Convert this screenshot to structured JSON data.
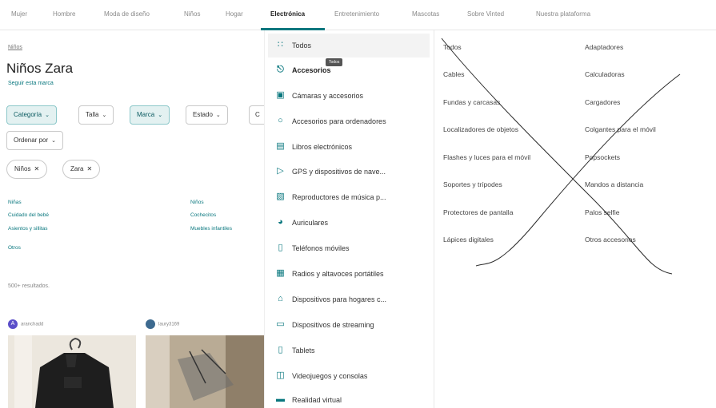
{
  "nav": {
    "items": [
      "Mujer",
      "Hombre",
      "Moda de diseño",
      "Niños",
      "Hogar",
      "Electrónica",
      "Entretenimiento",
      "Mascotas",
      "Sobre Vinted",
      "Nuestra plataforma"
    ],
    "active": "Electrónica",
    "accent": "#09777e"
  },
  "page": {
    "breadcrumb": "Niños",
    "title": "Niños Zara",
    "follow": "Seguir esta marca",
    "filters": [
      "Categoría",
      "Talla",
      "Marca",
      "Estado",
      "C"
    ],
    "sort": "Ordenar por",
    "chips": [
      "Niños",
      "Zara"
    ],
    "subcategories_left": [
      "Niñas",
      "Cuidado del bebé",
      "Asientos y sillitas",
      "Otros"
    ],
    "subcategories_right": [
      "Niños",
      "Cochecitos",
      "Muebles infantiles"
    ],
    "results": "500+ resultados.",
    "users": [
      "aranchadd",
      "laury3169"
    ],
    "avatar_letter": "A"
  },
  "menu": {
    "items": [
      {
        "label": "Todos",
        "icon": "grid-icon"
      },
      {
        "label": "Accesorios",
        "icon": "plug-icon"
      },
      {
        "label": "Cámaras y accesorios",
        "icon": "camera-icon"
      },
      {
        "label": "Accesorios para ordenadores",
        "icon": "mouse-icon"
      },
      {
        "label": "Libros electrónicos",
        "icon": "ebook-icon"
      },
      {
        "label": "GPS y dispositivos de nave...",
        "icon": "navigation-icon"
      },
      {
        "label": "Reproductores de música p...",
        "icon": "music-player-icon"
      },
      {
        "label": "Auriculares",
        "icon": "headphones-icon"
      },
      {
        "label": "Teléfonos móviles",
        "icon": "phone-icon"
      },
      {
        "label": "Radios y altavoces portátiles",
        "icon": "radio-icon"
      },
      {
        "label": "Dispositivos para hogares c...",
        "icon": "smart-home-icon"
      },
      {
        "label": "Dispositivos de streaming",
        "icon": "tv-icon"
      },
      {
        "label": "Tablets",
        "icon": "tablet-icon"
      },
      {
        "label": "Videojuegos y consolas",
        "icon": "gamepad-icon"
      },
      {
        "label": "Realidad virtual",
        "icon": "vr-icon"
      }
    ],
    "tooltip": "Todos",
    "subitems_left": [
      "Todos",
      "Cables",
      "Fundas y carcasas",
      "Localizadores de objetos",
      "Flashes y luces para el móvil",
      "Soportes y trípodes",
      "Protectores de pantalla",
      "Lápices digitales"
    ],
    "subitems_right": [
      "Adaptadores",
      "Calculadoras",
      "Cargadores",
      "Colgantes para el móvil",
      "Popsockets",
      "Mandos a distancia",
      "Palos selfie",
      "Otros accesorios"
    ]
  }
}
